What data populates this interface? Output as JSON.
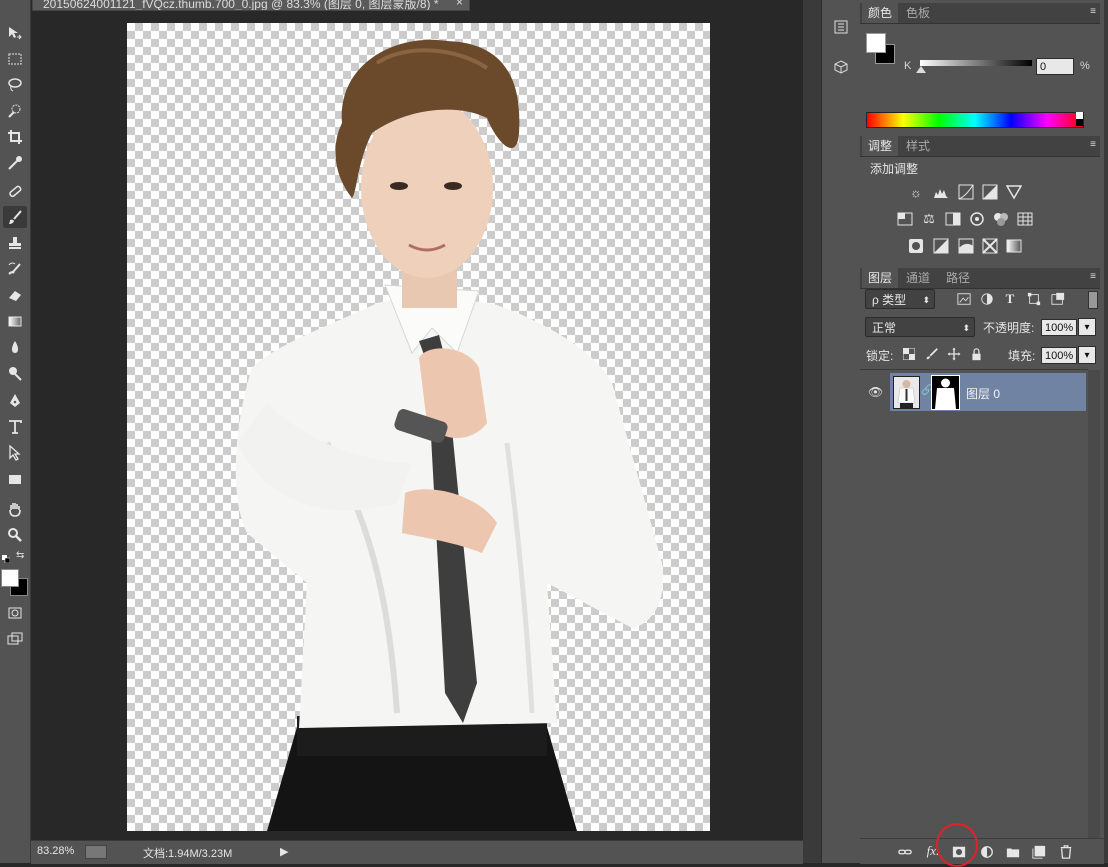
{
  "document": {
    "tab_title": "20150624001121_fVQcz.thumb.700_0.jpg @ 83.3% (图层 0, 图层蒙版/8) *",
    "close": "×"
  },
  "status": {
    "zoom": "83.28%",
    "doc_info": "文档:1.94M/3.23M",
    "arrow": "▶"
  },
  "color_panel": {
    "tabs": [
      "颜色",
      "色板"
    ],
    "channel_label": "K",
    "channel_value": "0",
    "unit": "%",
    "foreground": "#ffffff",
    "background": "#000000"
  },
  "adjust_panel": {
    "tabs": [
      "调整",
      "样式"
    ],
    "heading": "添加调整"
  },
  "layers_panel": {
    "tabs": [
      "图层",
      "通道",
      "路径"
    ],
    "filter_label": "ρ 类型",
    "blend_mode": "正常",
    "opacity_label": "不透明度:",
    "opacity_value": "100%",
    "lock_label": "锁定:",
    "fill_label": "填充:",
    "fill_value": "100%",
    "layers": [
      {
        "name": "图层 0",
        "visible": true,
        "selected": true
      }
    ],
    "selected_color": "#7183a2"
  },
  "icons": {
    "panel_menu": "≡",
    "dropdown": "⬍",
    "small_dropdown": "▾"
  }
}
